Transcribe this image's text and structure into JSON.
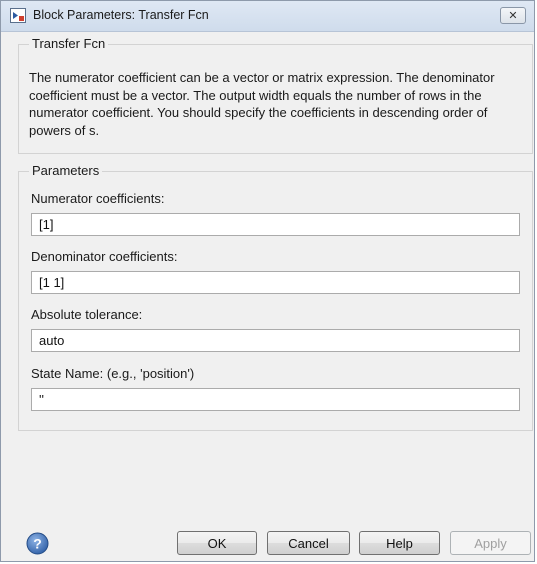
{
  "window": {
    "title": "Block Parameters: Transfer Fcn",
    "close_label": "✕"
  },
  "block": {
    "legend": "Transfer Fcn",
    "description": "The numerator coefficient can be a vector or matrix expression. The denominator coefficient must be a vector. The output width equals the number of rows in the numerator coefficient. You should specify the coefficients in descending order of powers of s."
  },
  "parameters": {
    "legend": "Parameters",
    "numerator": {
      "label": "Numerator coefficients:",
      "value": "[1]"
    },
    "denominator": {
      "label": "Denominator coefficients:",
      "value": "[1 1]"
    },
    "tolerance": {
      "label": "Absolute tolerance:",
      "value": "auto"
    },
    "state_name": {
      "label": "State Name: (e.g., 'position')",
      "value": "''"
    }
  },
  "buttons": {
    "ok": "OK",
    "cancel": "Cancel",
    "help": "Help",
    "apply": "Apply"
  },
  "colors": {
    "help_icon": "#3b6fb6",
    "window_bg": "#f0f0f0"
  }
}
